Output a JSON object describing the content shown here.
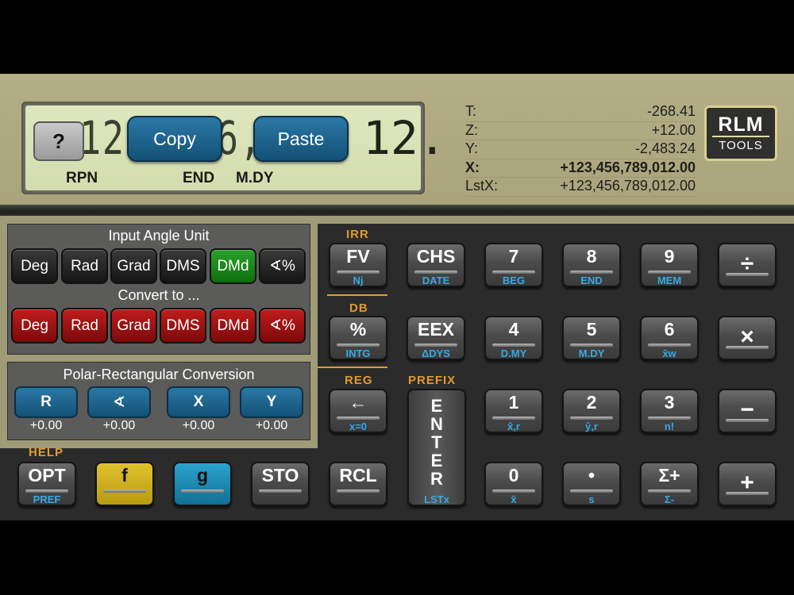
{
  "display": {
    "digits": "123,456,789,",
    "digits_right": "12.",
    "help_label": "?",
    "copy_label": "Copy",
    "paste_label": "Paste",
    "annunciators": {
      "rpn": "RPN",
      "end": "END",
      "mdy": "M.DY"
    }
  },
  "stack": [
    {
      "label": "T:",
      "value": "-268.41"
    },
    {
      "label": "Z:",
      "value": "+12.00"
    },
    {
      "label": "Y:",
      "value": "-2,483.24"
    },
    {
      "label": "X:",
      "value": "+123,456,789,012.00"
    },
    {
      "label": "LstX:",
      "value": "+123,456,789,012.00"
    }
  ],
  "logo": {
    "line1": "RLM",
    "line2": "TOOLS"
  },
  "angle_panel": {
    "title": "Input Angle Unit",
    "input_buttons": [
      "Deg",
      "Rad",
      "Grad",
      "DMS",
      "DMd",
      "∢%"
    ],
    "convert_title": "Convert to ...",
    "convert_buttons": [
      "Deg",
      "Rad",
      "Grad",
      "DMS",
      "DMd",
      "∢%"
    ]
  },
  "polar_panel": {
    "title": "Polar-Rectangular Conversion",
    "buttons": [
      "R",
      "∢",
      "X",
      "Y"
    ],
    "values": [
      "+0.00",
      "+0.00",
      "+0.00",
      "+0.00"
    ]
  },
  "function_labels": {
    "irr": "IRR",
    "db": "DB",
    "reg": "REG",
    "prefix": "PREFIX",
    "help": "HELP"
  },
  "keys": {
    "fv": {
      "main": "FV",
      "sub": "Nj"
    },
    "chs": {
      "main": "CHS",
      "sub": "DATE"
    },
    "k7": {
      "main": "7",
      "sub": "BEG"
    },
    "k8": {
      "main": "8",
      "sub": "END"
    },
    "k9": {
      "main": "9",
      "sub": "MEM"
    },
    "div": {
      "main": "÷"
    },
    "pct": {
      "main": "%",
      "sub": "INTG"
    },
    "eex": {
      "main": "EEX",
      "sub": "ΔDYS"
    },
    "k4": {
      "main": "4",
      "sub": "D.MY"
    },
    "k5": {
      "main": "5",
      "sub": "M.DY"
    },
    "k6": {
      "main": "6",
      "sub": "x̄w"
    },
    "mul": {
      "main": "×"
    },
    "back": {
      "main": "←",
      "sub": "x=0"
    },
    "enter": {
      "letters": "E N T E R",
      "sub": "LSTx"
    },
    "k1": {
      "main": "1",
      "sub": "x̂,r"
    },
    "k2": {
      "main": "2",
      "sub": "ŷ,r"
    },
    "k3": {
      "main": "3",
      "sub": "n!"
    },
    "sub_op": {
      "main": "−"
    },
    "opt": {
      "main": "OPT",
      "sub": "PREF"
    },
    "f": {
      "main": "f"
    },
    "g": {
      "main": "g"
    },
    "sto": {
      "main": "STO"
    },
    "rcl": {
      "main": "RCL"
    },
    "k0": {
      "main": "0",
      "sub": "x̄"
    },
    "dot": {
      "main": "•",
      "sub": "s"
    },
    "sigma": {
      "main": "Σ+",
      "sub": "Σ-"
    },
    "add": {
      "main": "+"
    }
  }
}
